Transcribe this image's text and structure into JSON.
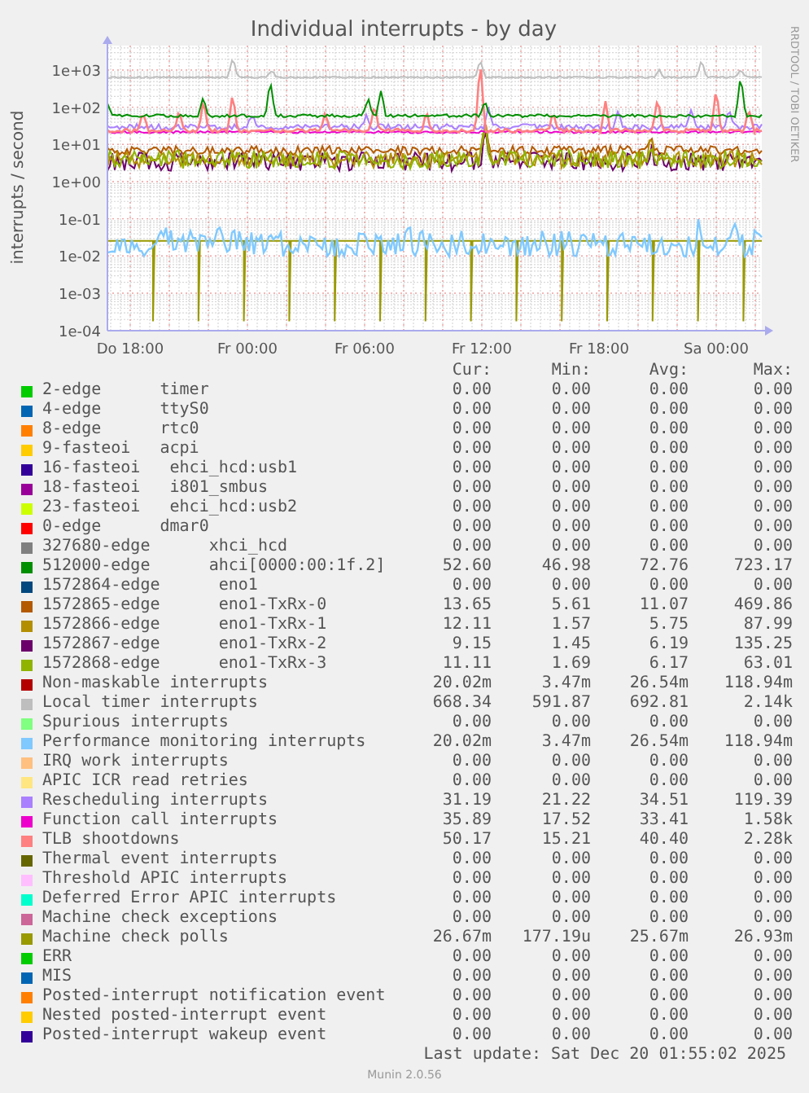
{
  "graph": {
    "title": "Individual interrupts - by day",
    "y_axis_label": "interrupts / second",
    "side_credit": "RRDTOOL / TOBI OETIKER",
    "y_ticks": [
      "1e+03",
      "1e+02",
      "1e+01",
      "1e+00",
      "1e-01",
      "1e-02",
      "1e-03",
      "1e-04"
    ],
    "x_ticks": [
      "Do 18:00",
      "Fr 00:00",
      "Fr 06:00",
      "Fr 12:00",
      "Fr 18:00",
      "Sa 00:00"
    ]
  },
  "legend": {
    "columns": [
      "Cur:",
      "Min:",
      "Avg:",
      "Max:"
    ],
    "items": [
      {
        "name": "2-edge      timer",
        "color": "#00cc00",
        "cur": "0.00",
        "min": "0.00",
        "avg": "0.00",
        "max": "0.00"
      },
      {
        "name": "4-edge      ttyS0",
        "color": "#0066b3",
        "cur": "0.00",
        "min": "0.00",
        "avg": "0.00",
        "max": "0.00"
      },
      {
        "name": "8-edge      rtc0",
        "color": "#ff8000",
        "cur": "0.00",
        "min": "0.00",
        "avg": "0.00",
        "max": "0.00"
      },
      {
        "name": "9-fasteoi   acpi",
        "color": "#ffcc00",
        "cur": "0.00",
        "min": "0.00",
        "avg": "0.00",
        "max": "0.00"
      },
      {
        "name": "16-fasteoi   ehci_hcd:usb1",
        "color": "#330099",
        "cur": "0.00",
        "min": "0.00",
        "avg": "0.00",
        "max": "0.00"
      },
      {
        "name": "18-fasteoi   i801_smbus",
        "color": "#990099",
        "cur": "0.00",
        "min": "0.00",
        "avg": "0.00",
        "max": "0.00"
      },
      {
        "name": "23-fasteoi   ehci_hcd:usb2",
        "color": "#ccff00",
        "cur": "0.00",
        "min": "0.00",
        "avg": "0.00",
        "max": "0.00"
      },
      {
        "name": "0-edge      dmar0",
        "color": "#ff0000",
        "cur": "0.00",
        "min": "0.00",
        "avg": "0.00",
        "max": "0.00"
      },
      {
        "name": "327680-edge      xhci_hcd",
        "color": "#808080",
        "cur": "0.00",
        "min": "0.00",
        "avg": "0.00",
        "max": "0.00"
      },
      {
        "name": "512000-edge      ahci[0000:00:1f.2]",
        "color": "#008f00",
        "cur": "52.60",
        "min": "46.98",
        "avg": "72.76",
        "max": "723.17"
      },
      {
        "name": "1572864-edge      eno1",
        "color": "#00487d",
        "cur": "0.00",
        "min": "0.00",
        "avg": "0.00",
        "max": "0.00"
      },
      {
        "name": "1572865-edge      eno1-TxRx-0",
        "color": "#b35a00",
        "cur": "13.65",
        "min": "5.61",
        "avg": "11.07",
        "max": "469.86"
      },
      {
        "name": "1572866-edge      eno1-TxRx-1",
        "color": "#b38f00",
        "cur": "12.11",
        "min": "1.57",
        "avg": "5.75",
        "max": "87.99"
      },
      {
        "name": "1572867-edge      eno1-TxRx-2",
        "color": "#6b006b",
        "cur": "9.15",
        "min": "1.45",
        "avg": "6.19",
        "max": "135.25"
      },
      {
        "name": "1572868-edge      eno1-TxRx-3",
        "color": "#8fb300",
        "cur": "11.11",
        "min": "1.69",
        "avg": "6.17",
        "max": "63.01"
      },
      {
        "name": "Non-maskable interrupts",
        "color": "#b30000",
        "cur": "20.02m",
        "min": "3.47m",
        "avg": "26.54m",
        "max": "118.94m"
      },
      {
        "name": "Local timer interrupts",
        "color": "#bebebe",
        "cur": "668.34",
        "min": "591.87",
        "avg": "692.81",
        "max": "2.14k"
      },
      {
        "name": "Spurious interrupts",
        "color": "#80ff80",
        "cur": "0.00",
        "min": "0.00",
        "avg": "0.00",
        "max": "0.00"
      },
      {
        "name": "Performance monitoring interrupts",
        "color": "#80c9ff",
        "cur": "20.02m",
        "min": "3.47m",
        "avg": "26.54m",
        "max": "118.94m"
      },
      {
        "name": "IRQ work interrupts",
        "color": "#ffc080",
        "cur": "0.00",
        "min": "0.00",
        "avg": "0.00",
        "max": "0.00"
      },
      {
        "name": "APIC ICR read retries",
        "color": "#ffe680",
        "cur": "0.00",
        "min": "0.00",
        "avg": "0.00",
        "max": "0.00"
      },
      {
        "name": "Rescheduling interrupts",
        "color": "#aa80ff",
        "cur": "31.19",
        "min": "21.22",
        "avg": "34.51",
        "max": "119.39"
      },
      {
        "name": "Function call interrupts",
        "color": "#ee00cc",
        "cur": "35.89",
        "min": "17.52",
        "avg": "33.41",
        "max": "1.58k"
      },
      {
        "name": "TLB shootdowns",
        "color": "#ff8080",
        "cur": "50.17",
        "min": "15.21",
        "avg": "40.40",
        "max": "2.28k"
      },
      {
        "name": "Thermal event interrupts",
        "color": "#666600",
        "cur": "0.00",
        "min": "0.00",
        "avg": "0.00",
        "max": "0.00"
      },
      {
        "name": "Threshold APIC interrupts",
        "color": "#ffbfff",
        "cur": "0.00",
        "min": "0.00",
        "avg": "0.00",
        "max": "0.00"
      },
      {
        "name": "Deferred Error APIC interrupts",
        "color": "#00ffcc",
        "cur": "0.00",
        "min": "0.00",
        "avg": "0.00",
        "max": "0.00"
      },
      {
        "name": "Machine check exceptions",
        "color": "#cc6699",
        "cur": "0.00",
        "min": "0.00",
        "avg": "0.00",
        "max": "0.00"
      },
      {
        "name": "Machine check polls",
        "color": "#999900",
        "cur": "26.67m",
        "min": "177.19u",
        "avg": "25.67m",
        "max": "26.93m"
      },
      {
        "name": "ERR",
        "color": "#00cc00",
        "cur": "0.00",
        "min": "0.00",
        "avg": "0.00",
        "max": "0.00"
      },
      {
        "name": "MIS",
        "color": "#0066b3",
        "cur": "0.00",
        "min": "0.00",
        "avg": "0.00",
        "max": "0.00"
      },
      {
        "name": "Posted-interrupt notification event",
        "color": "#ff8000",
        "cur": "0.00",
        "min": "0.00",
        "avg": "0.00",
        "max": "0.00"
      },
      {
        "name": "Nested posted-interrupt event",
        "color": "#ffcc00",
        "cur": "0.00",
        "min": "0.00",
        "avg": "0.00",
        "max": "0.00"
      },
      {
        "name": "Posted-interrupt wakeup event",
        "color": "#330099",
        "cur": "0.00",
        "min": "0.00",
        "avg": "0.00",
        "max": "0.00"
      }
    ]
  },
  "footer": {
    "last_update": "Last update: Sat Dec 20 01:55:02 2025",
    "version": "Munin 2.0.56"
  }
}
